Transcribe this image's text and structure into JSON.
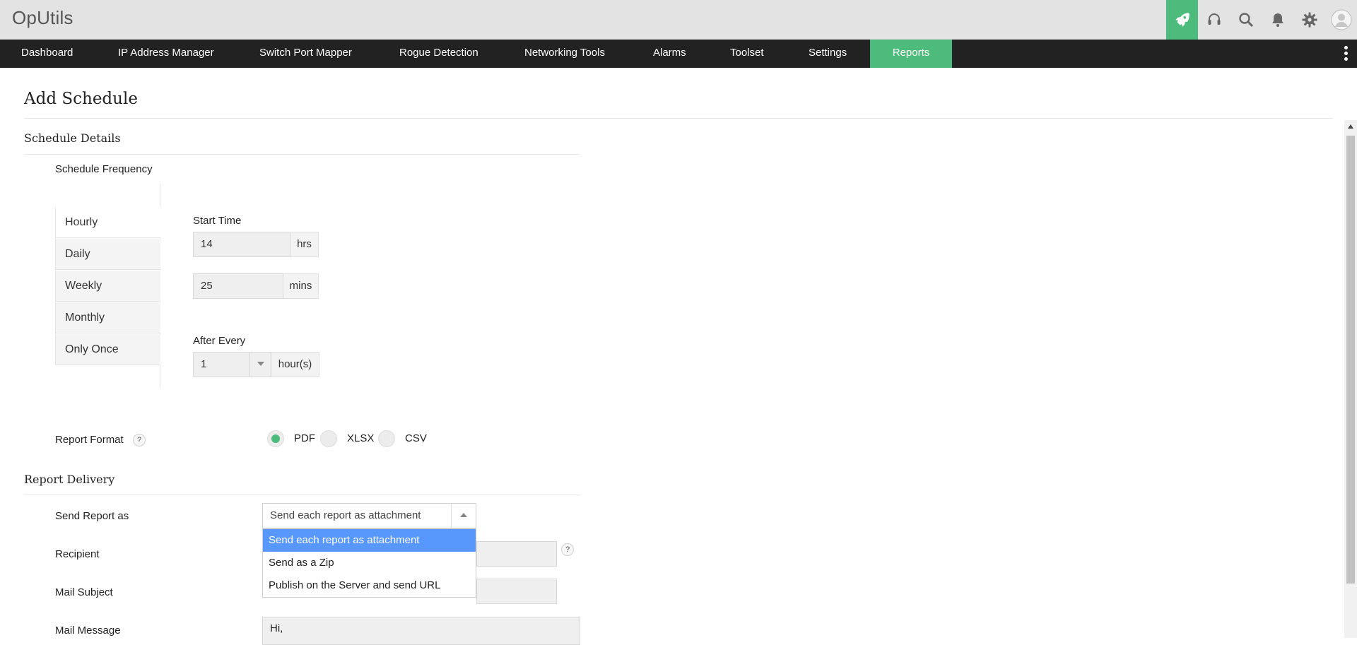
{
  "app": {
    "title": "OpUtils"
  },
  "top_icons": [
    "rocket-icon",
    "headset-icon",
    "search-icon",
    "bell-icon",
    "gear-icon",
    "user-avatar-icon"
  ],
  "nav": {
    "items": [
      {
        "label": "Dashboard"
      },
      {
        "label": "IP Address Manager"
      },
      {
        "label": "Switch Port Mapper"
      },
      {
        "label": "Rogue Detection"
      },
      {
        "label": "Networking Tools"
      },
      {
        "label": "Alarms"
      },
      {
        "label": "Toolset"
      },
      {
        "label": "Settings"
      },
      {
        "label": "Reports",
        "active": true
      }
    ]
  },
  "page": {
    "title": "Add Schedule"
  },
  "schedule_details": {
    "title": "Schedule Details",
    "frequency_label": "Schedule Frequency",
    "tabs": [
      "Hourly",
      "Daily",
      "Weekly",
      "Monthly",
      "Only Once"
    ],
    "active_tab": "Hourly",
    "start_time_label": "Start Time",
    "hours_value": "14",
    "hours_unit": "hrs",
    "minutes_value": "25",
    "minutes_unit": "mins",
    "after_every_label": "After Every",
    "after_every_value": "1",
    "after_every_unit": "hour(s)"
  },
  "report_format": {
    "label": "Report Format",
    "help": "?",
    "options": [
      "PDF",
      "XLSX",
      "CSV"
    ],
    "selected": "PDF"
  },
  "report_delivery": {
    "title": "Report Delivery",
    "send_as_label": "Send Report as",
    "send_as_value": "Send each report as attachment",
    "send_as_options": [
      "Send each report as attachment",
      "Send as a Zip",
      "Publish on the Server and send URL"
    ],
    "recipient_label": "Recipient",
    "recipient_help": "?",
    "mail_subject_label": "Mail Subject",
    "mail_message_label": "Mail Message",
    "mail_message_value": "Hi,"
  },
  "colors": {
    "accent": "#4dbb7b",
    "nav_bg": "#222222",
    "dropdown_highlight": "#5897fb"
  }
}
